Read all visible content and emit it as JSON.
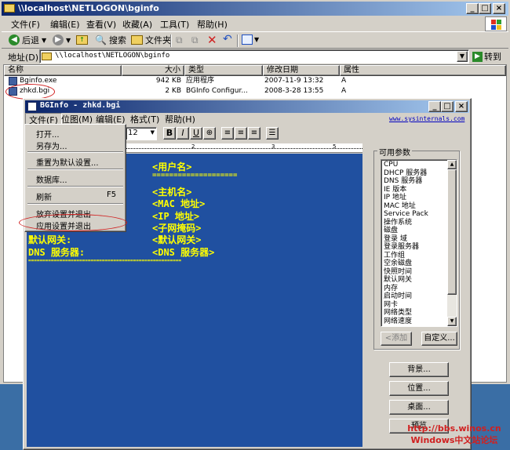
{
  "explorer": {
    "title": "\\\\localhost\\NETLOGON\\bginfo",
    "menu": [
      "文件(F)",
      "编辑(E)",
      "查看(V)",
      "收藏(A)",
      "工具(T)",
      "帮助(H)"
    ],
    "toolbar": {
      "back": "后退",
      "search": "搜索",
      "folders": "文件夹"
    },
    "address_label": "地址(D)",
    "address_value": "\\\\localhost\\NETLOGON\\bginfo",
    "go": "转到",
    "columns": [
      "名称",
      "大小",
      "类型",
      "修改日期",
      "属性"
    ],
    "files": [
      {
        "name": "Bginfo.exe",
        "size": "942 KB",
        "type": "应用程序",
        "date": "2007-11-9 13:32",
        "attr": "A"
      },
      {
        "name": "zhkd.bgi",
        "size": "2 KB",
        "type": "BGInfo Configur...",
        "date": "2008-3-28 13:55",
        "attr": "A"
      }
    ]
  },
  "bginfo": {
    "title": "BGInfo - zhkd.bgi",
    "menu": [
      "文件(F)",
      "位图(M)",
      "编辑(E)",
      "格式(T)",
      "帮助(H)"
    ],
    "link": "www.sysinternals.com",
    "font_size": "12",
    "editor_lines": [
      {
        "label": "",
        "value": "<用户名>"
      },
      {
        "label": "",
        "value": "===================="
      },
      {
        "label": "",
        "value": "<主机名>"
      },
      {
        "label": "",
        "value": "<MAC 地址>"
      },
      {
        "label": "",
        "value": "<IP 地址>"
      },
      {
        "label": "",
        "value": "<子网掩码>"
      },
      {
        "label": "默认网关:",
        "value": "<默认网关>"
      },
      {
        "label": "DNS 服务器:",
        "value": "<DNS 服务器>"
      },
      {
        "label": "",
        "value": "======================================================"
      }
    ],
    "params_label": "可用参数",
    "params": [
      "CPU",
      "DHCP 服务器",
      "DNS 服务器",
      "IE 版本",
      "IP 地址",
      "MAC 地址",
      "Service Pack",
      "操作系统",
      "磁盘",
      "登录 域",
      "登录服务器",
      "工作组",
      "空余磁盘",
      "快照时间",
      "默认网关",
      "内存",
      "启动时间",
      "网卡",
      "网络类型",
      "网络速度"
    ],
    "add_button": "<添加",
    "custom_button": "自定义...",
    "side_buttons": [
      "背景...",
      "位置...",
      "桌面...",
      "预览"
    ]
  },
  "file_menu": {
    "items": [
      {
        "label": "打开...",
        "shortcut": ""
      },
      {
        "label": "另存为...",
        "shortcut": ""
      },
      {
        "label": "重置为默认设置...",
        "shortcut": ""
      },
      {
        "label": "数据库...",
        "shortcut": ""
      },
      {
        "label": "刷新",
        "shortcut": "F5"
      },
      {
        "label": "放弃设置并退出",
        "shortcut": ""
      },
      {
        "label": "应用设置并退出",
        "shortcut": ""
      }
    ]
  },
  "watermark": {
    "url": "http://bbs.winos.cn",
    "name": "Windows中文站论坛"
  }
}
